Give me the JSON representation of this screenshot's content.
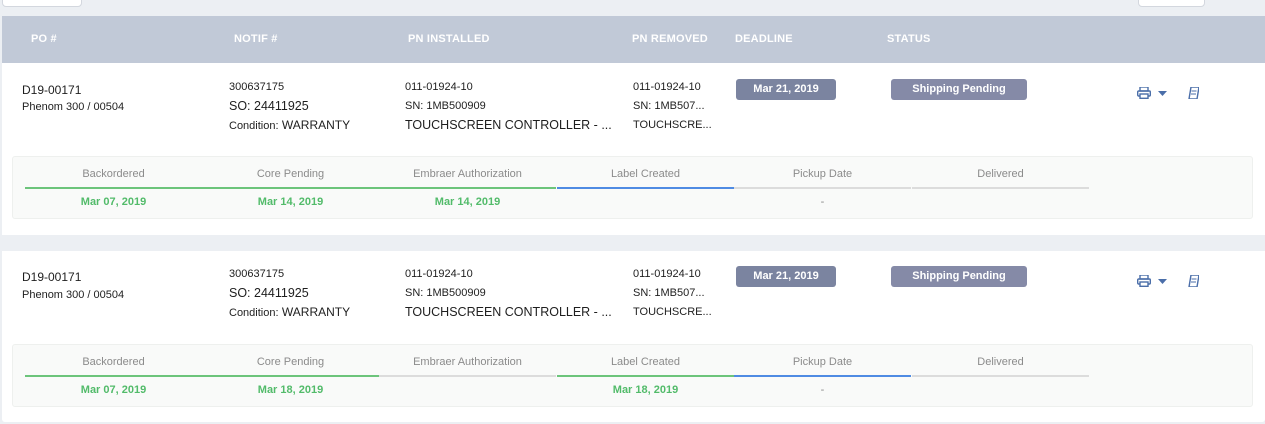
{
  "header": {
    "po": "PO #",
    "notif": "NOTIF #",
    "pn_installed": "PN INSTALLED",
    "pn_removed": "PN REMOVED",
    "deadline": "DEADLINE",
    "status": "STATUS"
  },
  "rows": [
    {
      "po": "D19-00171",
      "aircraft": "Phenom 300 / 00504",
      "notif": "300637175",
      "so": "SO: 24411925",
      "condition_label": "Condition:",
      "condition_value": "WARRANTY",
      "pn_installed": "011-01924-10",
      "sn_installed": "SN: 1MB500909",
      "desc_installed": "TOUCHSCREEN CONTROLLER - ...",
      "pn_removed": "011-01924-10",
      "sn_removed": "SN: 1MB507...",
      "desc_removed": "TOUCHSCRE...",
      "deadline": "Mar 21, 2019",
      "status": "Shipping Pending",
      "icons": [
        "printer-icon",
        "chevron-down-icon",
        "book-icon"
      ],
      "steps": [
        {
          "label": "Backordered",
          "date": "Mar 07, 2019",
          "state": "done"
        },
        {
          "label": "Core Pending",
          "date": "Mar 14, 2019",
          "state": "done"
        },
        {
          "label": "Embraer Authorization",
          "date": "Mar 14, 2019",
          "state": "done"
        },
        {
          "label": "Label Created",
          "date": "",
          "state": "active"
        },
        {
          "label": "Pickup Date",
          "date": "-",
          "state": "pending"
        },
        {
          "label": "Delivered",
          "date": "",
          "state": "pending"
        }
      ]
    },
    {
      "po": "D19-00171",
      "aircraft": "Phenom 300 / 00504",
      "notif": "300637175",
      "so": "SO: 24411925",
      "condition_label": "Condition:",
      "condition_value": "WARRANTY",
      "pn_installed": "011-01924-10",
      "sn_installed": "SN: 1MB500909",
      "desc_installed": "TOUCHSCREEN CONTROLLER - ...",
      "pn_removed": "011-01924-10",
      "sn_removed": "SN: 1MB507...",
      "desc_removed": "TOUCHSCRE...",
      "deadline": "Mar 21, 2019",
      "status": "Shipping Pending",
      "icons": [
        "printer-icon",
        "chevron-down-icon",
        "book-icon"
      ],
      "steps": [
        {
          "label": "Backordered",
          "date": "Mar 07, 2019",
          "state": "done"
        },
        {
          "label": "Core Pending",
          "date": "Mar 18, 2019",
          "state": "done"
        },
        {
          "label": "Embraer Authorization",
          "date": "",
          "state": "pending"
        },
        {
          "label": "Label Created",
          "date": "Mar 18, 2019",
          "state": "done"
        },
        {
          "label": "Pickup Date",
          "date": "-",
          "state": "active"
        },
        {
          "label": "Delivered",
          "date": "",
          "state": "pending"
        }
      ]
    }
  ],
  "colors": {
    "header_bg": "#c1c9d7",
    "badge_date": "#7b84a0",
    "badge_status": "#858aa7",
    "step_done": "#6cc47b",
    "step_active": "#4f8be3",
    "step_pending": "#dcdcdc",
    "date_green": "#52bb6a",
    "icon_blue": "#4a6ea9"
  }
}
